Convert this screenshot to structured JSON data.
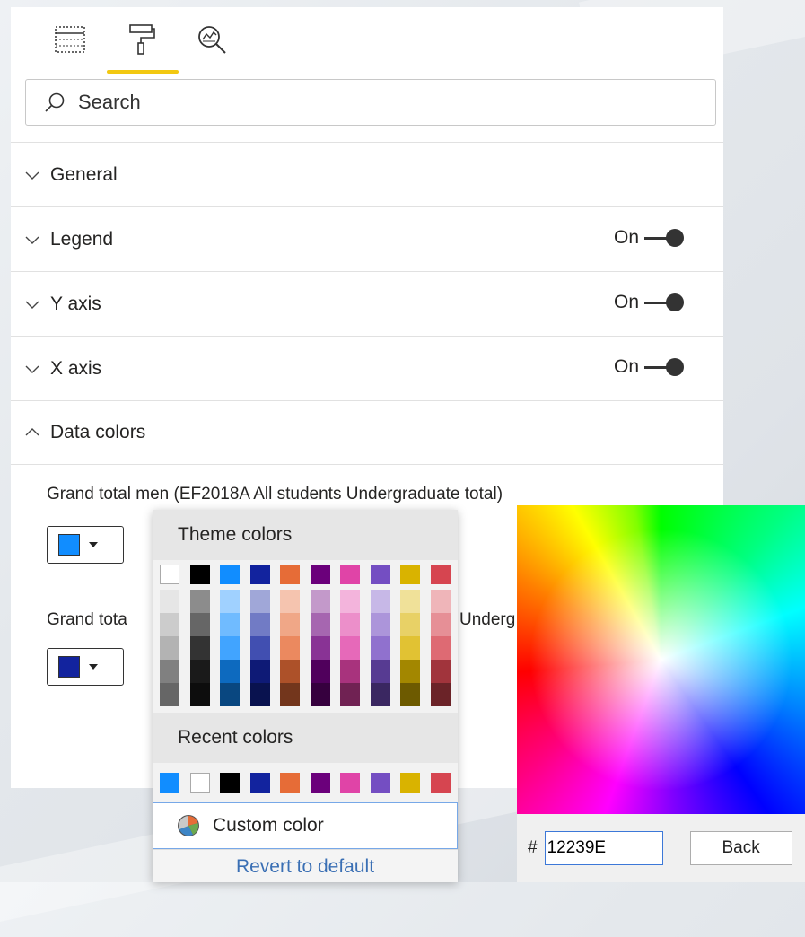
{
  "search": {
    "placeholder": "Search"
  },
  "sections": [
    {
      "title": "General",
      "expanded": false
    },
    {
      "title": "Legend",
      "expanded": false,
      "toggle": "On"
    },
    {
      "title": "Y axis",
      "expanded": false,
      "toggle": "On"
    },
    {
      "title": "X axis",
      "expanded": false,
      "toggle": "On"
    },
    {
      "title": "Data colors",
      "expanded": true
    }
  ],
  "data_colors": [
    {
      "label": "Grand total men (EF2018A All students Undergraduate total)",
      "color": "#118DFF"
    },
    {
      "label": "Grand tota",
      "label_tail": "Underg",
      "color": "#12239E"
    }
  ],
  "picker": {
    "theme_header": "Theme colors",
    "theme_top": [
      "#FFFFFF",
      "#000000",
      "#118DFF",
      "#12239E",
      "#E66C37",
      "#6B007B",
      "#E044A7",
      "#744EC2",
      "#D9B300",
      "#D64550"
    ],
    "theme_shades": [
      [
        "#E6E6E6",
        "#CCCCCC",
        "#B3B3B3",
        "#808080",
        "#666666"
      ],
      [
        "#8C8C8C",
        "#666666",
        "#333333",
        "#1A1A1A",
        "#0D0D0D"
      ],
      [
        "#A0D1FF",
        "#70BBFF",
        "#41A4FF",
        "#0D6ABF",
        "#094780"
      ],
      [
        "#A0A7D8",
        "#717BC5",
        "#414FB1",
        "#0E1A76",
        "#09124F"
      ],
      [
        "#F5C4AF",
        "#F0A787",
        "#EB895F",
        "#AD5129",
        "#73361C"
      ],
      [
        "#C399CA",
        "#A666B0",
        "#893395",
        "#50005C",
        "#36003E"
      ],
      [
        "#F3B4DC",
        "#EC8FCA",
        "#E669B9",
        "#A8337D",
        "#702253"
      ],
      [
        "#C7B8E7",
        "#AC95DA",
        "#9071CE",
        "#573B92",
        "#3A2761"
      ],
      [
        "#F0E199",
        "#E8D166",
        "#E1C233",
        "#A38700",
        "#6D5A00"
      ],
      [
        "#EFB5B9",
        "#E68F96",
        "#DE6A73",
        "#A1343C",
        "#6B2328"
      ]
    ],
    "recent_header": "Recent colors",
    "recent": [
      "#118DFF",
      "#FFFFFF",
      "#000000",
      "#12239E",
      "#E66C37",
      "#6B007B",
      "#E044A7",
      "#744EC2",
      "#D9B300",
      "#D64550"
    ],
    "custom_label": "Custom color",
    "revert_label": "Revert to default"
  },
  "spectrum": {
    "hash": "#",
    "hex_value": "12239E",
    "back_label": "Back"
  }
}
